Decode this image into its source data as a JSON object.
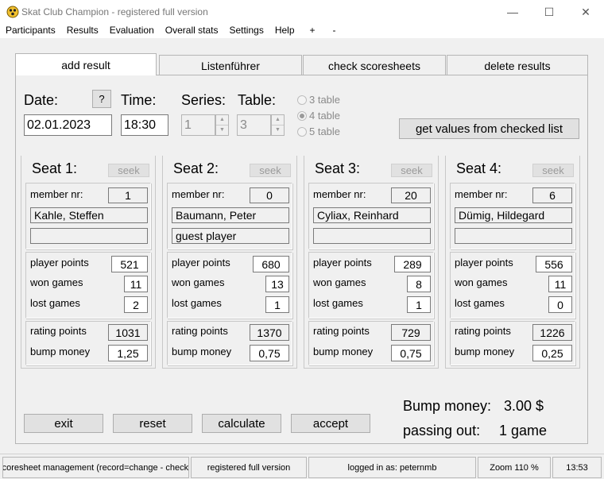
{
  "window": {
    "title": "Skat Club Champion - registered full version",
    "minimize": "—",
    "maximize": "☐",
    "close": "✕",
    "icon": "skat-club-icon"
  },
  "menu": [
    "Participants",
    "Results",
    "Evaluation",
    "Overall stats",
    "Settings",
    "Help",
    "+",
    "-"
  ],
  "tabs": {
    "add": "add result",
    "list": "Listenführer",
    "check": "check scoresheets",
    "delete": "delete results"
  },
  "form": {
    "date_label": "Date:",
    "help": "?",
    "date_value": "02.01.2023",
    "time_label": "Time:",
    "time_value": "18:30",
    "series_label": "Series:",
    "series_value": "1",
    "table_label": "Table:",
    "table_value": "3",
    "table_options": [
      "3 table",
      "4 table",
      "5 table"
    ],
    "get_values": "get values from checked list"
  },
  "labels": {
    "member_nr": "member nr:",
    "player_points": "player points",
    "won_games": "won games",
    "lost_games": "lost games",
    "rating_points": "rating points",
    "bump_money": "bump money",
    "seek": "seek"
  },
  "seats": [
    {
      "title": "Seat 1:",
      "member_nr": "1",
      "name": "Kahle, Steffen",
      "extra": "",
      "player_points": "521",
      "won_games": "11",
      "lost_games": "2",
      "rating_points": "1031",
      "bump_money": "1,25"
    },
    {
      "title": "Seat 2:",
      "member_nr": "0",
      "name": "Baumann, Peter",
      "extra": "guest player",
      "player_points": "680",
      "won_games": "13",
      "lost_games": "1",
      "rating_points": "1370",
      "bump_money": "0,75"
    },
    {
      "title": "Seat 3:",
      "member_nr": "20",
      "name": "Cyliax, Reinhard",
      "extra": "",
      "player_points": "289",
      "won_games": "8",
      "lost_games": "1",
      "rating_points": "729",
      "bump_money": "0,75"
    },
    {
      "title": "Seat 4:",
      "member_nr": "6",
      "name": "Dümig, Hildegard",
      "extra": "",
      "player_points": "556",
      "won_games": "11",
      "lost_games": "0",
      "rating_points": "1226",
      "bump_money": "0,25"
    }
  ],
  "buttons": {
    "exit": "exit",
    "reset": "reset",
    "calculate": "calculate",
    "accept": "accept"
  },
  "summary": {
    "bump_label": "Bump money:",
    "bump_value": "3.00 $",
    "passing_label": "passing out:",
    "passing_value": "1 game"
  },
  "status": {
    "mode": "scoresheet management (record=change - check -",
    "license": "registered full version",
    "user": "logged in as: peternmb",
    "zoom": "Zoom 110 %",
    "clock": "13:53"
  }
}
